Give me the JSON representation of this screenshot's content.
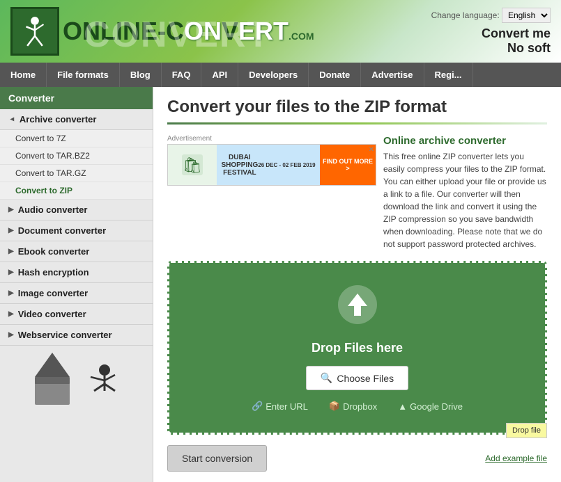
{
  "header": {
    "logo_text_1": "ONLINE-C",
    "logo_text_2": "NV",
    "logo_text_3": "ERT",
    "logo_com": ".COM",
    "watermark": "CONVERT",
    "lang_label": "Change language:",
    "lang_value": "English",
    "tagline_1": "Convert me",
    "tagline_2": "No soft"
  },
  "nav": {
    "items": [
      {
        "label": "Home",
        "active": false
      },
      {
        "label": "File formats",
        "active": false
      },
      {
        "label": "Blog",
        "active": false
      },
      {
        "label": "FAQ",
        "active": false
      },
      {
        "label": "API",
        "active": false
      },
      {
        "label": "Developers",
        "active": false
      },
      {
        "label": "Donate",
        "active": false
      },
      {
        "label": "Advertise",
        "active": false
      },
      {
        "label": "Regi...",
        "active": false
      }
    ]
  },
  "sidebar": {
    "title": "Converter",
    "sections": [
      {
        "label": "Archive converter",
        "expanded": true,
        "sub_items": [
          {
            "label": "Convert to 7Z",
            "active": false
          },
          {
            "label": "Convert to TAR.BZ2",
            "active": false
          },
          {
            "label": "Convert to TAR.GZ",
            "active": false
          },
          {
            "label": "Convert to ZIP",
            "active": true
          }
        ]
      },
      {
        "label": "Audio converter",
        "expanded": false,
        "sub_items": []
      },
      {
        "label": "Document converter",
        "expanded": false,
        "sub_items": []
      },
      {
        "label": "Ebook converter",
        "expanded": false,
        "sub_items": []
      },
      {
        "label": "Hash encryption",
        "expanded": false,
        "sub_items": []
      },
      {
        "label": "Image converter",
        "expanded": false,
        "sub_items": []
      },
      {
        "label": "Video converter",
        "expanded": false,
        "sub_items": []
      },
      {
        "label": "Webservice converter",
        "expanded": false,
        "sub_items": []
      }
    ]
  },
  "content": {
    "title": "Convert your files to the ZIP format",
    "ad_label": "Advertisement",
    "ad_date": "26 DEC - 02 FEB 2019",
    "ad_btn": "FIND OUT MORE >",
    "online_converter_title": "Online archive converter",
    "description": "This free online ZIP converter lets you easily compress your files to the ZIP format. You can either upload your file or provide us a link to a file. Our converter will then download the link and convert it using the ZIP compression so you save bandwidth when downloading. Please note that we do not support password protected archives.",
    "drop_text": "Drop Files here",
    "choose_files": "Choose Files",
    "enter_url": "Enter URL",
    "dropbox": "Dropbox",
    "google_drive": "Google Drive",
    "tooltip": "Drop file",
    "start_btn": "Start conversion",
    "add_example": "Add example file"
  }
}
